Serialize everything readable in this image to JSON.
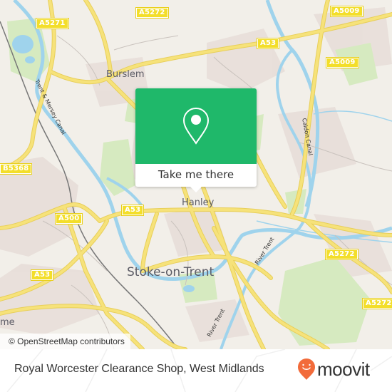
{
  "map": {
    "attribution": "© OpenStreetMap contributors",
    "colors": {
      "land": "#f2efe9",
      "road": "#f6e27a",
      "water": "#9fd3ec",
      "park": "#d6eac0",
      "urban": "#e6dcd7",
      "accent": "#1fb86a"
    },
    "places": [
      {
        "name": "Burslem",
        "kind": "town"
      },
      {
        "name": "Hanley",
        "kind": "town"
      },
      {
        "name": "Stoke-on-Trent",
        "kind": "city"
      },
      {
        "name": "me",
        "kind": "town"
      }
    ],
    "road_shields": [
      {
        "ref": "A5271"
      },
      {
        "ref": "A5272"
      },
      {
        "ref": "A5009"
      },
      {
        "ref": "A53"
      },
      {
        "ref": "A5009"
      },
      {
        "ref": "B5368"
      },
      {
        "ref": "A53"
      },
      {
        "ref": "A500"
      },
      {
        "ref": "A53"
      },
      {
        "ref": "A5272"
      },
      {
        "ref": "A5272"
      }
    ],
    "water_labels": [
      {
        "name": "Trent & Mersey Canal"
      },
      {
        "name": "Caldon Canal"
      },
      {
        "name": "River Trent"
      },
      {
        "name": "River Trent"
      }
    ]
  },
  "popup": {
    "icon": "map-pin-icon",
    "action_label": "Take me there"
  },
  "footer": {
    "title": "Royal Worcester Clearance Shop, West Midlands",
    "brand": "moovit",
    "brand_color": "#f26b3a"
  }
}
